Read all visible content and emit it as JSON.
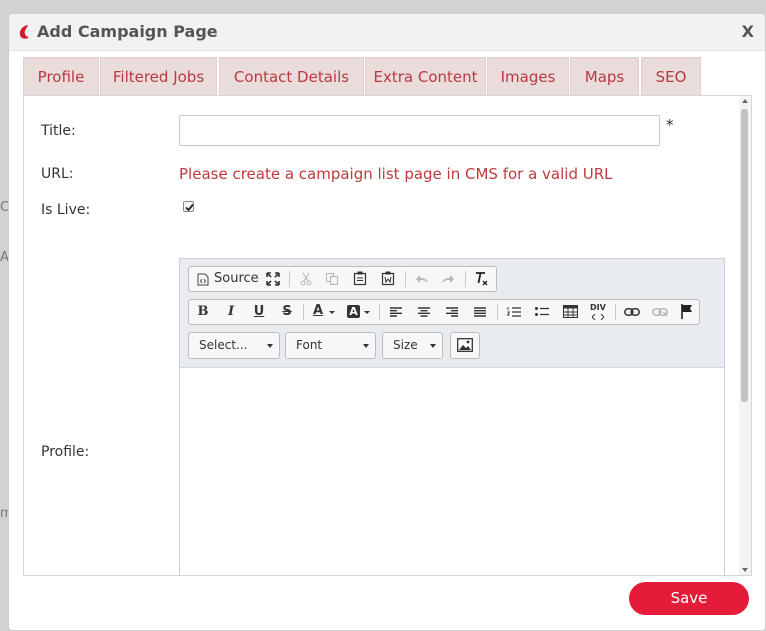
{
  "backdrop": {
    "fragments": [
      "C",
      "Al",
      "m"
    ]
  },
  "dialog": {
    "title": "Add Campaign Page",
    "close_label": "X",
    "tabs": [
      {
        "label": "Profile"
      },
      {
        "label": "Filtered Jobs"
      },
      {
        "label": "Contact Details"
      },
      {
        "label": "Extra Content"
      },
      {
        "label": "Images"
      },
      {
        "label": "Maps"
      },
      {
        "label": "SEO"
      }
    ],
    "form": {
      "title_label": "Title:",
      "title_value": "",
      "required_mark": "*",
      "url_label": "URL:",
      "url_message": "Please create a campaign list page in CMS for a valid URL",
      "is_live_label": "Is Live:",
      "is_live_checked": true,
      "profile_label": "Profile:"
    },
    "editor": {
      "source_label": "Source",
      "format_placeholder": "Select...",
      "font_label": "Font",
      "size_label": "Size",
      "toolbar_icons": [
        "source-icon",
        "maximize-icon",
        "cut-icon",
        "copy-icon",
        "paste-icon",
        "paste-word-icon",
        "undo-icon",
        "redo-icon",
        "remove-format-icon",
        "bold-icon",
        "italic-icon",
        "underline-icon",
        "strikethrough-icon",
        "text-color-icon",
        "background-color-icon",
        "align-left-icon",
        "align-center-icon",
        "align-right-icon",
        "justify-icon",
        "numbered-list-icon",
        "bulleted-list-icon",
        "table-icon",
        "div-icon",
        "link-icon",
        "unlink-icon",
        "anchor-flag-icon",
        "image-icon"
      ],
      "bold_glyph": "B",
      "italic_glyph": "I",
      "underline_glyph": "U",
      "strike_glyph": "S",
      "text_color_glyph": "A",
      "bg_color_glyph": "A",
      "div_glyph": "DIV"
    },
    "save_label": "Save"
  },
  "colors": {
    "accent": "#e41c3a",
    "tab_text": "#b8393f",
    "tab_bg": "#ebdcdc",
    "url_message": "#c0393c"
  }
}
